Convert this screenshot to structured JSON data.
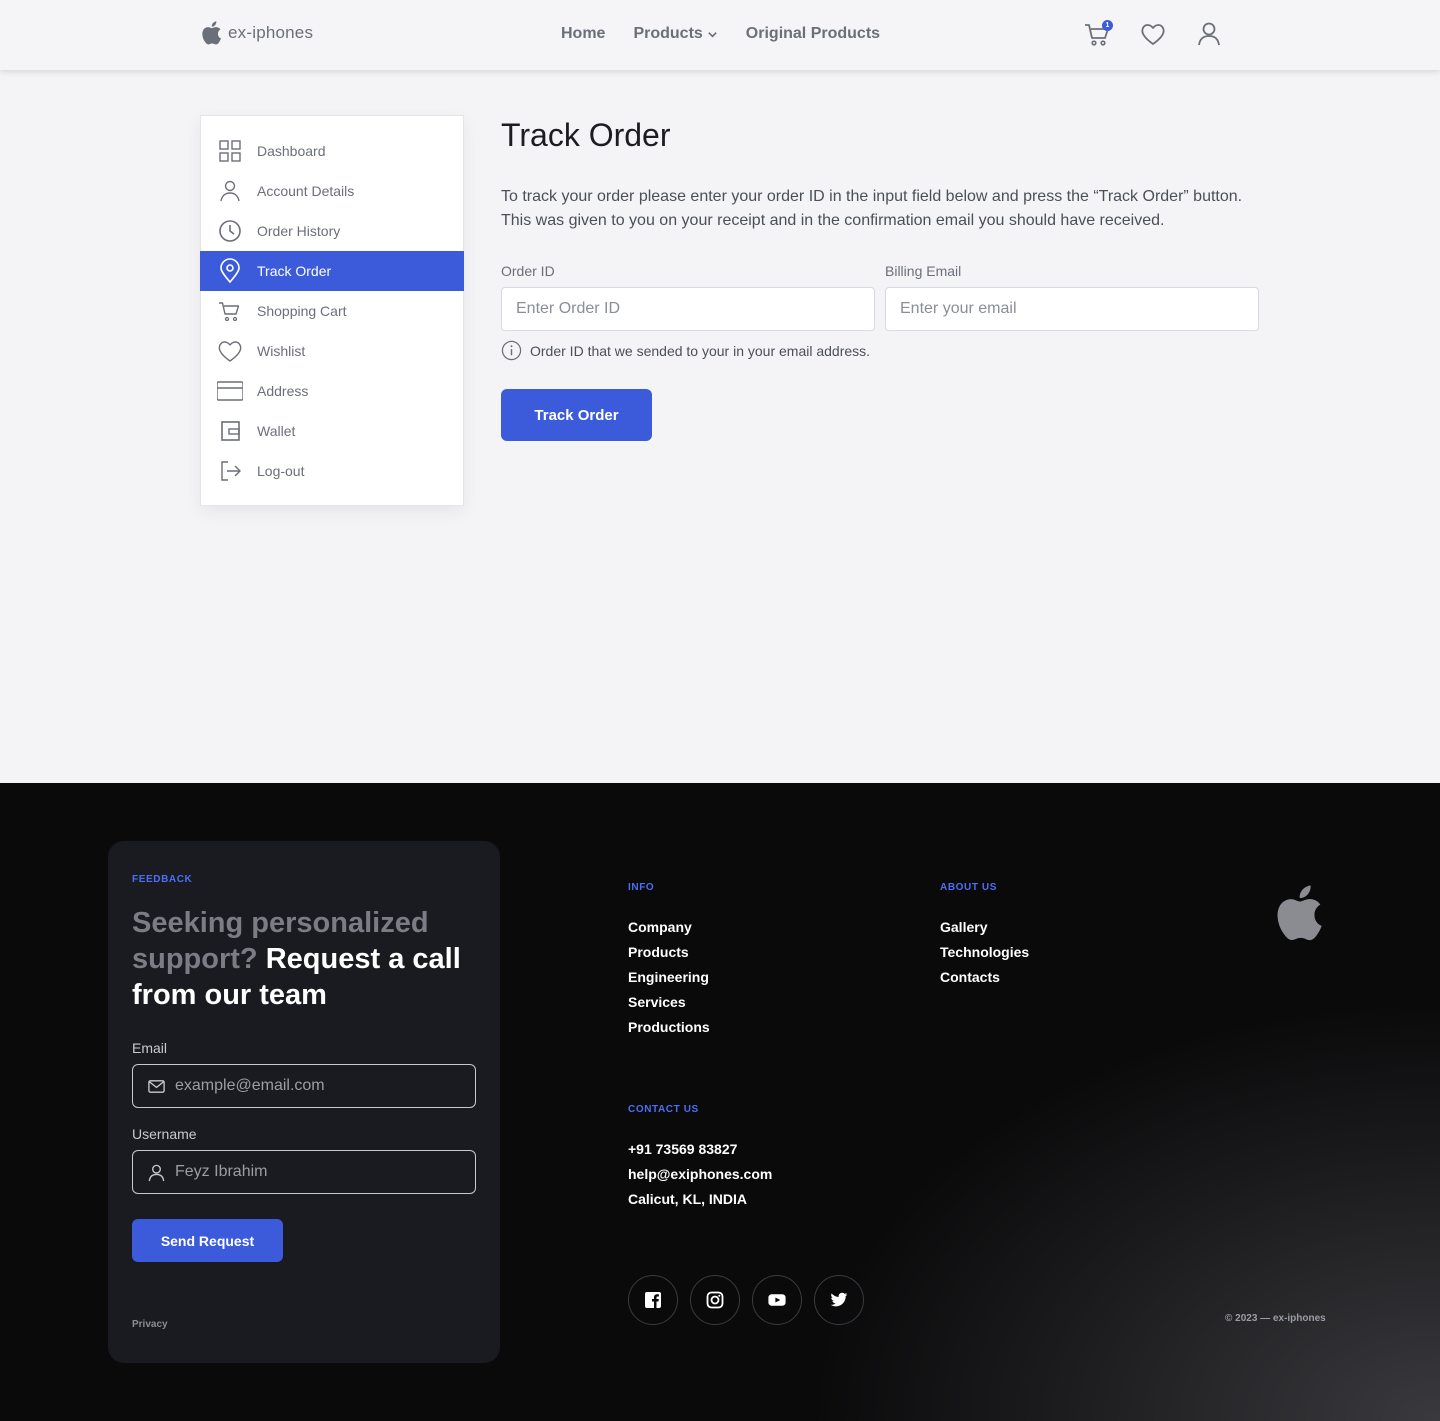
{
  "brand": {
    "name": "ex-iphones"
  },
  "nav": {
    "home": "Home",
    "products": "Products",
    "original_products": "Original Products"
  },
  "header": {
    "cart_count": "1"
  },
  "sidebar": {
    "items": [
      {
        "label": "Dashboard",
        "icon": "grid-icon"
      },
      {
        "label": "Account Details",
        "icon": "user-icon"
      },
      {
        "label": "Order History",
        "icon": "clock-icon"
      },
      {
        "label": "Track Order",
        "icon": "location-pin-icon",
        "active": true
      },
      {
        "label": "Shopping Cart",
        "icon": "cart-icon"
      },
      {
        "label": "Wishlist",
        "icon": "heart-icon"
      },
      {
        "label": "Address",
        "icon": "card-icon"
      },
      {
        "label": "Wallet",
        "icon": "wallet-icon"
      },
      {
        "label": "Log-out",
        "icon": "logout-icon"
      }
    ]
  },
  "main": {
    "title": "Track Order",
    "intro": "To track your order please enter your order ID in the input field below and press the “Track Order” button. This was given to you on your receipt and in the confirmation email you should have received.",
    "order_id_label": "Order ID",
    "order_id_placeholder": "Enter Order ID",
    "email_label": "Billing Email",
    "email_placeholder": "Enter your email",
    "hint": "Order ID that we sended to your in your email address.",
    "button": "Track Order"
  },
  "footer": {
    "feedback": {
      "kicker": "FEEDBACK",
      "heading_muted": "Seeking personalized support?",
      "heading_bright": "Request a call from our team",
      "email_label": "Email",
      "email_placeholder": "example@email.com",
      "username_label": "Username",
      "username_placeholder": "Feyz Ibrahim",
      "button": "Send Request",
      "privacy": "Privacy"
    },
    "info": {
      "kicker": "INFO",
      "links": [
        "Company",
        "Products",
        "Engineering",
        "Services",
        "Productions"
      ]
    },
    "about": {
      "kicker": "ABOUT US",
      "links": [
        "Gallery",
        "Technologies",
        "Contacts"
      ]
    },
    "contact": {
      "kicker": "CONTACT US",
      "lines": [
        "+91 73569 83827",
        "help@exiphones.com",
        "Calicut, KL, INDIA"
      ]
    },
    "socials": [
      "facebook-icon",
      "instagram-icon",
      "youtube-icon",
      "twitter-icon"
    ],
    "copyright": "© 2023 — ex-iphones"
  },
  "colors": {
    "accent": "#3b5bdb",
    "kicker": "#4c6ef5",
    "footer_bg": "#0a0a0b"
  }
}
